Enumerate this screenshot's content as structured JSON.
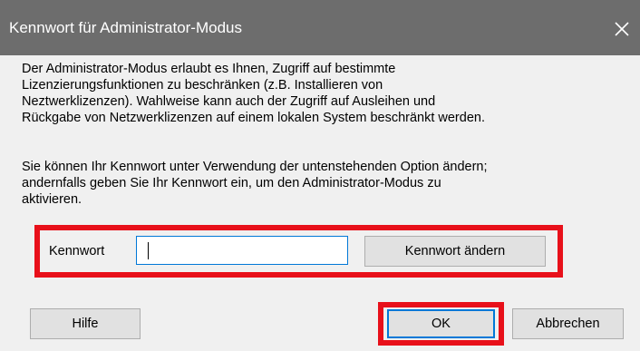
{
  "dialog": {
    "title": "Kennwort für Administrator-Modus",
    "close_icon": "close-icon"
  },
  "description": {
    "paragraph1": [
      "Der Administrator-Modus erlaubt es Ihnen, Zugriff auf bestimmte",
      "Lizenzierungsfunktionen zu beschränken (z.B. Installieren von",
      "Neztwerklizenzen).  Wahlweise kann auch der Zugriff  auf Ausleihen und",
      "Rückgabe von Netzwerklizenzen auf einem lokalen System beschränkt werden."
    ],
    "paragraph2": [
      "Sie können Ihr Kennwort unter Verwendung der untenstehenden Option ändern;",
      "andernfalls geben Sie Ihr Kennwort ein, um den Administrator-Modus zu",
      "aktivieren."
    ]
  },
  "password": {
    "label": "Kennwort",
    "value": "",
    "change_button": "Kennwort ändern"
  },
  "buttons": {
    "help": "Hilfe",
    "ok": "OK",
    "cancel": "Abbrechen"
  },
  "colors": {
    "titlebar": "#6d6d6d",
    "highlight": "#e8101a",
    "focus": "#0078d7"
  }
}
